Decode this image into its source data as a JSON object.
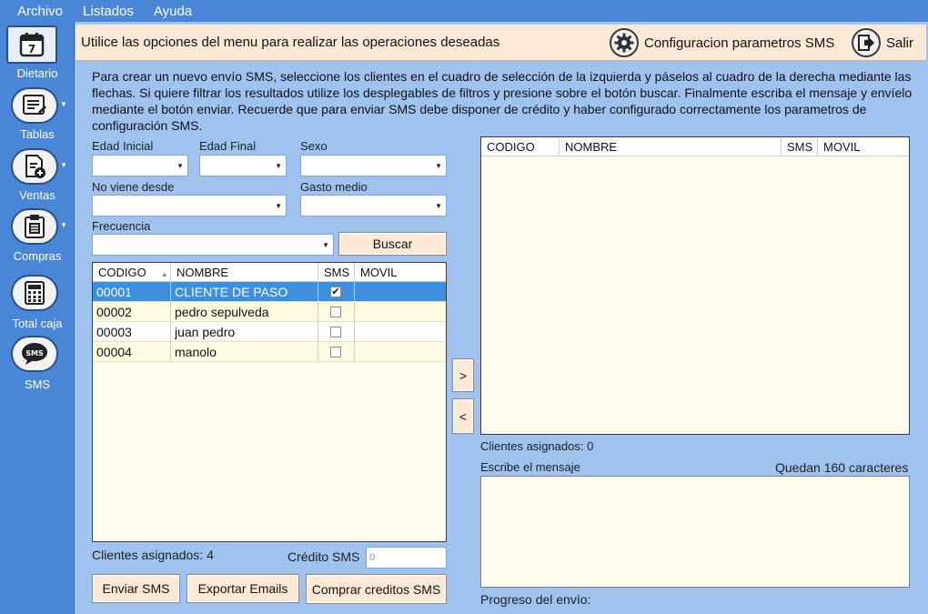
{
  "menu": [
    "Archivo",
    "Listados",
    "Ayuda"
  ],
  "sidebar": [
    {
      "label": "Dietario",
      "icon": "calendar-icon"
    },
    {
      "label": "Tablas",
      "icon": "list-icon"
    },
    {
      "label": "Ventas",
      "icon": "document-add-icon"
    },
    {
      "label": "Compras",
      "icon": "clipboard-icon"
    },
    {
      "label": "Total caja",
      "icon": "calculator-icon"
    },
    {
      "label": "SMS",
      "icon": "sms-icon"
    }
  ],
  "calendar_day": "7",
  "sms_icon_text": "SMS",
  "header": {
    "title": "Utilice las opciones del menu para realizar las operaciones deseadas",
    "config_label": "Configuracion parametros SMS",
    "exit_label": "Salir"
  },
  "instructions": "Para crear un nuevo envío SMS, seleccione los clientes en el cuadro de selección de la izquierda y páselos al cuadro de la derecha mediante las flechas. Si quiere filtrar los resultados utilize los desplegables de filtros y presione sobre el botón buscar. Finalmente escriba el mensaje y envíelo mediante el botón enviar. Recuerde que para enviar SMS debe disponer de crédito y haber configurado correctamente los parametros de configuración SMS.",
  "filters": {
    "edad_inicial": "Edad Inicial",
    "edad_final": "Edad Final",
    "sexo": "Sexo",
    "no_viene": "No viene desde",
    "gasto": "Gasto medio",
    "frecuencia": "Frecuencia"
  },
  "buscar": "Buscar",
  "left_grid": {
    "columns": [
      "CODIGO",
      "NOMBRE",
      "SMS",
      "MOVIL"
    ],
    "rows": [
      {
        "codigo": "00001",
        "nombre": "CLIENTE DE PASO",
        "sms": true,
        "movil": ""
      },
      {
        "codigo": "00002",
        "nombre": "pedro sepulveda",
        "sms": false,
        "movil": ""
      },
      {
        "codigo": "00003",
        "nombre": "juan pedro",
        "sms": false,
        "movil": ""
      },
      {
        "codigo": "00004",
        "nombre": "manolo",
        "sms": false,
        "movil": ""
      }
    ]
  },
  "right_grid": {
    "columns": [
      "CODIGO",
      "NOMBRE",
      "SMS",
      "MOVIL"
    ]
  },
  "arrows": {
    "right": ">",
    "left": "<"
  },
  "clientes_left": "Clientes asignados: 4",
  "credito_label": "Crédito SMS",
  "credito_value": "0",
  "clientes_right": "Clientes asignados: 0",
  "mensaje_label": "Escribe el mensaje",
  "quedan": "Quedan 160 caracteres",
  "progreso": "Progreso del envío:",
  "buttons": {
    "enviar": "Enviar SMS",
    "exportar": "Exportar Emails",
    "comprar": "Comprar creditos SMS"
  }
}
